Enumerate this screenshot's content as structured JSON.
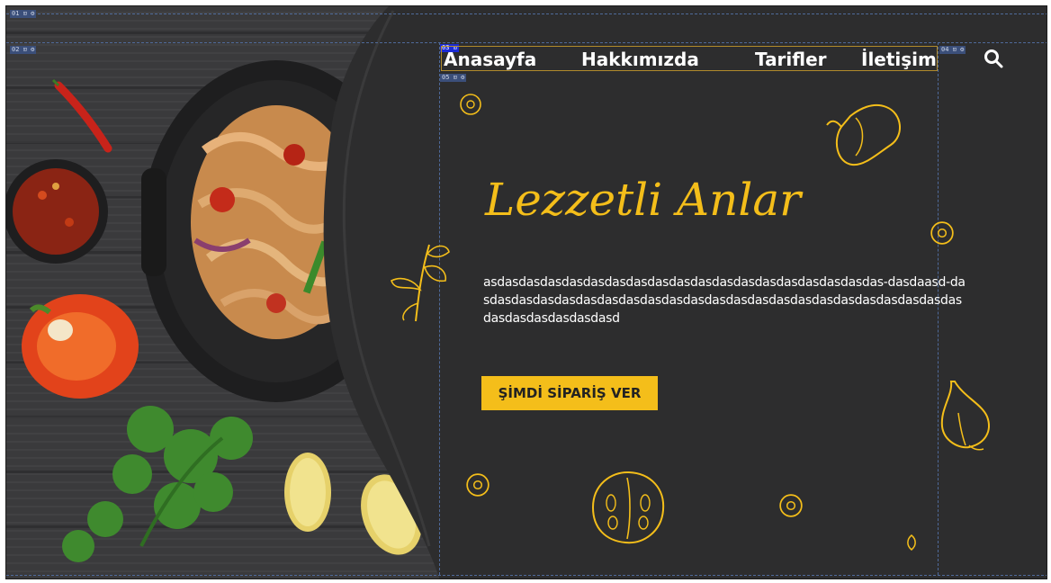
{
  "guide_tags": {
    "t1": "01 ⊡ ⚙",
    "t2": "02 ⊡ ⚙",
    "t3": "03 ⊡",
    "t4": "04 ⊡ ⚙",
    "t5": "05 ⊡ ⚙"
  },
  "nav": {
    "items": [
      "Anasayfa",
      "Hakkımızda",
      "Tarifler",
      "İletişim"
    ]
  },
  "hero": {
    "title": "Lezzetli Anlar",
    "body": "asdasdasdasdasdasdasdasdasdasdasdasdasdasdasdasdasdasdas-dasdaasd-dasdasdasdasdasdasdasdasdasdasdasdasdasdasdasdasdasdasdasdasdasdasdasdasdasdasdasdasdasd",
    "cta_label": "ŞİMDİ SİPARİŞ VER"
  },
  "colors": {
    "accent": "#f4be1a",
    "background": "#2b2b2b",
    "text": "#ffffff"
  }
}
